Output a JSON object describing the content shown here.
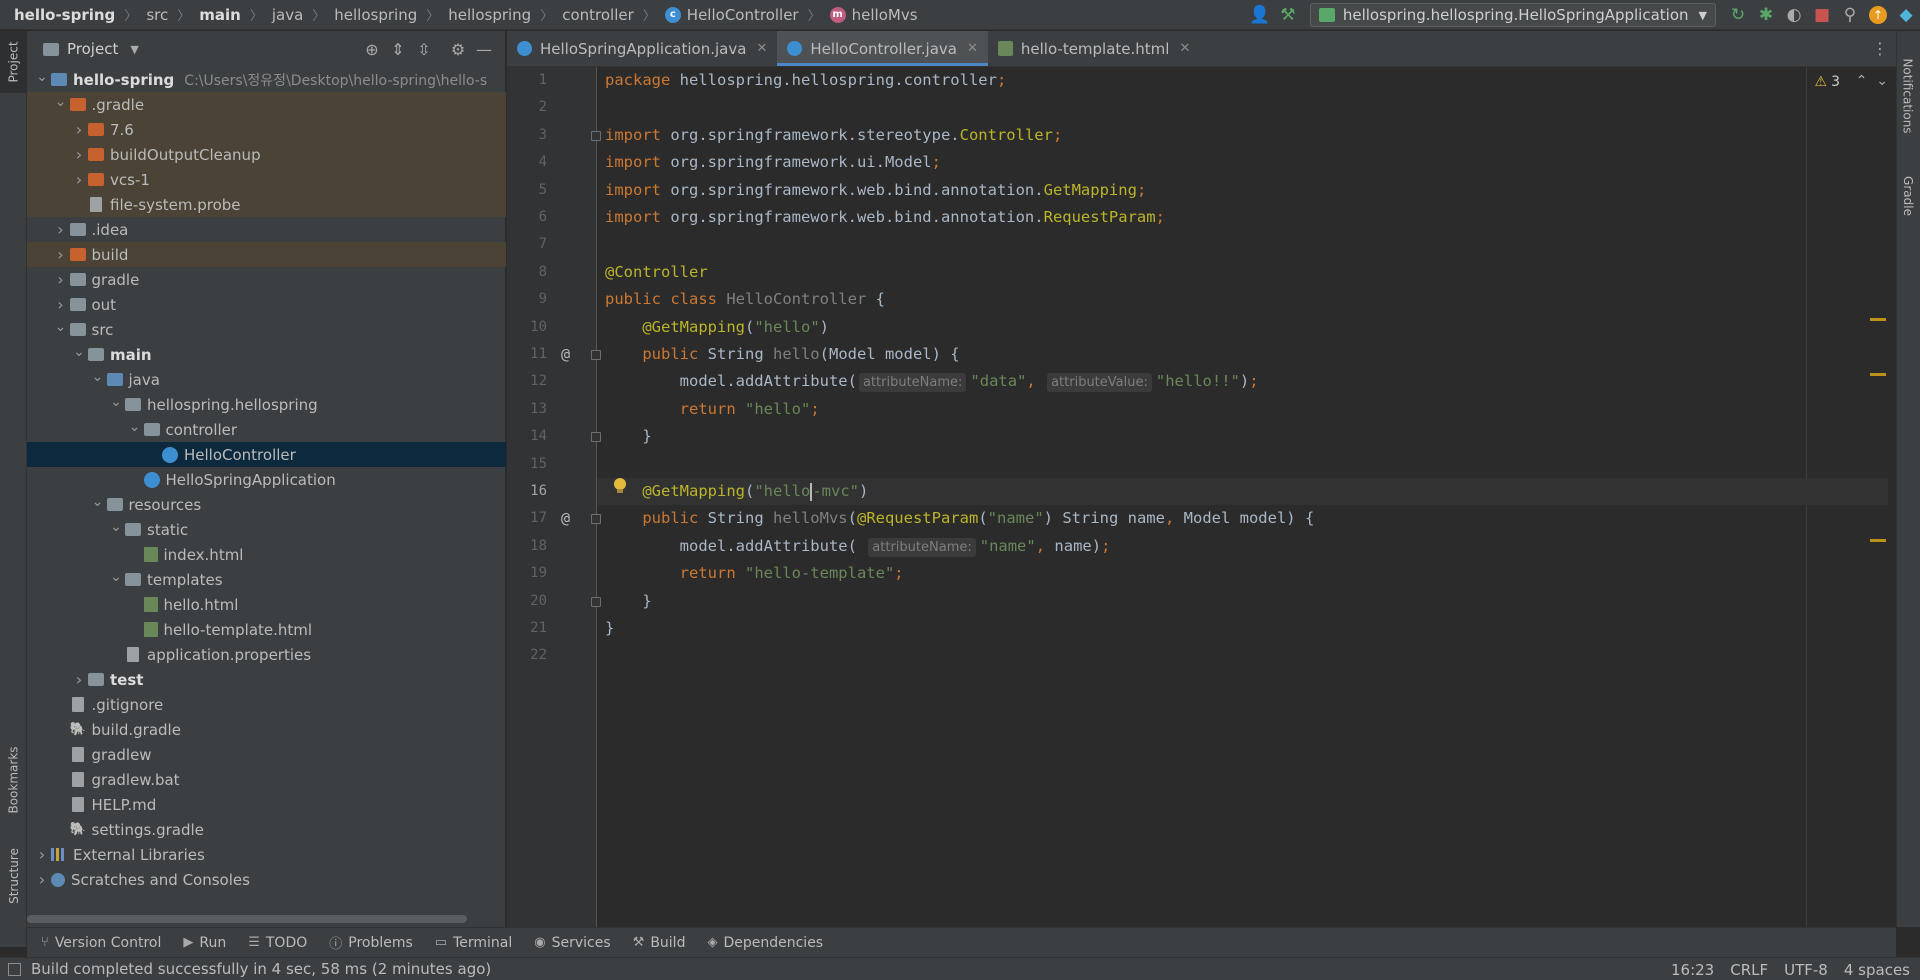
{
  "navbar": {
    "crumbs": [
      {
        "label": "hello-spring",
        "bold": true
      },
      {
        "label": "src"
      },
      {
        "label": "main",
        "bold": true
      },
      {
        "label": "java"
      },
      {
        "label": "hellospring"
      },
      {
        "label": "hellospring"
      },
      {
        "label": "controller"
      },
      {
        "label": "HelloController",
        "icon": "class-icon"
      },
      {
        "label": "helloMvs",
        "icon": "method-icon"
      }
    ],
    "run_config": "hellospring.hellospring.HelloSpringApplication"
  },
  "left_stripe": {
    "project": "Project",
    "bookmarks": "Bookmarks",
    "structure": "Structure"
  },
  "right_stripe": {
    "notifications": "Notifications",
    "gradle": "Gradle"
  },
  "project_panel": {
    "title": "Project",
    "tree": [
      {
        "level": 0,
        "arrow": "open",
        "icon": "folder-blue",
        "name": "hello-spring",
        "bold": true,
        "secondary": "C:\\Users\\정유정\\Desktop\\hello-spring\\hello-s"
      },
      {
        "level": 1,
        "arrow": "open",
        "icon": "folder-orange",
        "name": ".gradle",
        "excluded": true
      },
      {
        "level": 2,
        "arrow": "closed",
        "icon": "folder-orange",
        "name": "7.6",
        "excluded": true
      },
      {
        "level": 2,
        "arrow": "closed",
        "icon": "folder-orange",
        "name": "buildOutputCleanup",
        "excluded": true
      },
      {
        "level": 2,
        "arrow": "closed",
        "icon": "folder-orange",
        "name": "vcs-1",
        "excluded": true
      },
      {
        "level": 2,
        "arrow": "none",
        "icon": "file",
        "name": "file-system.probe",
        "excluded": true
      },
      {
        "level": 1,
        "arrow": "closed",
        "icon": "folder",
        "name": ".idea"
      },
      {
        "level": 1,
        "arrow": "closed",
        "icon": "folder-orange",
        "name": "build",
        "excluded": true
      },
      {
        "level": 1,
        "arrow": "closed",
        "icon": "folder",
        "name": "gradle"
      },
      {
        "level": 1,
        "arrow": "closed",
        "icon": "folder",
        "name": "out"
      },
      {
        "level": 1,
        "arrow": "open",
        "icon": "folder",
        "name": "src"
      },
      {
        "level": 2,
        "arrow": "open",
        "icon": "folder",
        "name": "main",
        "bold": true
      },
      {
        "level": 3,
        "arrow": "open",
        "icon": "folder-blue",
        "name": "java"
      },
      {
        "level": 4,
        "arrow": "open",
        "icon": "folder",
        "name": "hellospring.hellospring"
      },
      {
        "level": 5,
        "arrow": "open",
        "icon": "folder",
        "name": "controller"
      },
      {
        "level": 6,
        "arrow": "none",
        "icon": "classc",
        "name": "HelloController",
        "selected": true
      },
      {
        "level": 5,
        "arrow": "none",
        "icon": "classc",
        "name": "HelloSpringApplication"
      },
      {
        "level": 3,
        "arrow": "open",
        "icon": "folder-res",
        "name": "resources"
      },
      {
        "level": 4,
        "arrow": "open",
        "icon": "folder",
        "name": "static"
      },
      {
        "level": 5,
        "arrow": "none",
        "icon": "html",
        "name": "index.html"
      },
      {
        "level": 4,
        "arrow": "open",
        "icon": "folder",
        "name": "templates"
      },
      {
        "level": 5,
        "arrow": "none",
        "icon": "html",
        "name": "hello.html"
      },
      {
        "level": 5,
        "arrow": "none",
        "icon": "html",
        "name": "hello-template.html"
      },
      {
        "level": 4,
        "arrow": "none",
        "icon": "file",
        "name": "application.properties"
      },
      {
        "level": 2,
        "arrow": "closed",
        "icon": "folder",
        "name": "test",
        "bold": true
      },
      {
        "level": 1,
        "arrow": "none",
        "icon": "file",
        "name": ".gitignore"
      },
      {
        "level": 1,
        "arrow": "none",
        "icon": "gradle",
        "name": "build.gradle"
      },
      {
        "level": 1,
        "arrow": "none",
        "icon": "file",
        "name": "gradlew"
      },
      {
        "level": 1,
        "arrow": "none",
        "icon": "file",
        "name": "gradlew.bat"
      },
      {
        "level": 1,
        "arrow": "none",
        "icon": "file",
        "name": "HELP.md"
      },
      {
        "level": 1,
        "arrow": "none",
        "icon": "gradle",
        "name": "settings.gradle"
      },
      {
        "level": 0,
        "arrow": "closed",
        "icon": "libs",
        "name": "External Libraries"
      },
      {
        "level": 0,
        "arrow": "closed",
        "icon": "scratch",
        "name": "Scratches and Consoles"
      }
    ]
  },
  "tabs": [
    {
      "label": "HelloSpringApplication.java",
      "icon": "class",
      "active": false
    },
    {
      "label": "HelloController.java",
      "icon": "class",
      "active": true
    },
    {
      "label": "hello-template.html",
      "icon": "html",
      "active": false
    }
  ],
  "editor": {
    "warnings_count": "3",
    "current_line": 16,
    "lines": [
      [
        [
          "kw",
          "package "
        ],
        [
          "ty",
          "hellospring.hellospring.controller"
        ],
        [
          "kw",
          ";"
        ]
      ],
      [],
      [
        [
          "kw",
          "import "
        ],
        [
          "ty",
          "org.springframework.stereotype."
        ],
        [
          "an",
          "Controller"
        ],
        [
          "kw",
          ";"
        ]
      ],
      [
        [
          "kw",
          "import "
        ],
        [
          "ty",
          "org.springframework.ui.Model"
        ],
        [
          "kw",
          ";"
        ]
      ],
      [
        [
          "kw",
          "import "
        ],
        [
          "ty",
          "org.springframework.web.bind.annotation."
        ],
        [
          "an",
          "GetMapping"
        ],
        [
          "kw",
          ";"
        ]
      ],
      [
        [
          "kw",
          "import "
        ],
        [
          "ty",
          "org.springframework.web.bind.annotation."
        ],
        [
          "an",
          "RequestParam"
        ],
        [
          "kw",
          ";"
        ]
      ],
      [],
      [
        [
          "an",
          "@Controller"
        ]
      ],
      [
        [
          "kw",
          "public class "
        ],
        [
          "gr",
          "HelloController"
        ],
        [
          "ty",
          " {"
        ]
      ],
      [
        [
          "ty",
          "    "
        ],
        [
          "an",
          "@GetMapping"
        ],
        [
          "ty",
          "("
        ],
        [
          "st",
          "\"hello\""
        ],
        [
          "ty",
          ")"
        ]
      ],
      [
        [
          "ty",
          "    "
        ],
        [
          "kw",
          "public "
        ],
        [
          "ty",
          "String "
        ],
        [
          "gr",
          "hello"
        ],
        [
          "ty",
          "(Model model) {"
        ]
      ],
      [
        [
          "ty",
          "        model.addAttribute("
        ],
        [
          "hint",
          "attributeName:"
        ],
        [
          "st",
          "\"data\""
        ],
        [
          "kw",
          ", "
        ],
        [
          "hint",
          "attributeValue:"
        ],
        [
          "st",
          "\"hello!!\""
        ],
        [
          "ty",
          ")"
        ],
        [
          "kw",
          ";"
        ]
      ],
      [
        [
          "ty",
          "        "
        ],
        [
          "kw",
          "return "
        ],
        [
          "st",
          "\"hello\""
        ],
        [
          "kw",
          ";"
        ]
      ],
      [
        [
          "ty",
          "    }"
        ]
      ],
      [],
      [
        [
          "ty",
          "    "
        ],
        [
          "an",
          "@GetMapping"
        ],
        [
          "ty",
          "("
        ],
        [
          "st",
          "\"hello"
        ],
        [
          "caret",
          ""
        ],
        [
          "st",
          "-mvc\""
        ],
        [
          "ty",
          ")"
        ]
      ],
      [
        [
          "ty",
          "    "
        ],
        [
          "kw",
          "public "
        ],
        [
          "ty",
          "String "
        ],
        [
          "gr",
          "helloMvs"
        ],
        [
          "ty",
          "("
        ],
        [
          "an",
          "@RequestParam"
        ],
        [
          "ty",
          "("
        ],
        [
          "st",
          "\"name\""
        ],
        [
          "ty",
          ") String name"
        ],
        [
          "kw",
          ", "
        ],
        [
          "ty",
          "Model model) {"
        ]
      ],
      [
        [
          "ty",
          "        model.addAttribute( "
        ],
        [
          "hint",
          "attributeName:"
        ],
        [
          "st",
          "\"name\""
        ],
        [
          "kw",
          ", "
        ],
        [
          "ty",
          "name)"
        ],
        [
          "kw",
          ";"
        ]
      ],
      [
        [
          "ty",
          "        "
        ],
        [
          "kw",
          "return "
        ],
        [
          "st",
          "\"hello-template\""
        ],
        [
          "kw",
          ";"
        ]
      ],
      [
        [
          "ty",
          "    }"
        ]
      ],
      [
        [
          "ty",
          "}"
        ]
      ],
      []
    ]
  },
  "bottom_tools": [
    {
      "label": "Version Control",
      "icon": "vcs-icon",
      "glyph": "⑂"
    },
    {
      "label": "Run",
      "icon": "run-icon",
      "glyph": "▶"
    },
    {
      "label": "TODO",
      "icon": "todo-icon",
      "glyph": "☰"
    },
    {
      "label": "Problems",
      "icon": "problems-icon",
      "glyph": "ⓘ"
    },
    {
      "label": "Terminal",
      "icon": "terminal-icon",
      "glyph": "▭"
    },
    {
      "label": "Services",
      "icon": "services-icon",
      "glyph": "◉"
    },
    {
      "label": "Build",
      "icon": "build-icon",
      "glyph": "⚒"
    },
    {
      "label": "Dependencies",
      "icon": "dependencies-icon",
      "glyph": "◈"
    }
  ],
  "status": {
    "message": "Build completed successfully in 4 sec, 58 ms (2 minutes ago)",
    "position": "16:23",
    "line_sep": "CRLF",
    "encoding": "UTF-8",
    "indent": "4 spaces"
  }
}
